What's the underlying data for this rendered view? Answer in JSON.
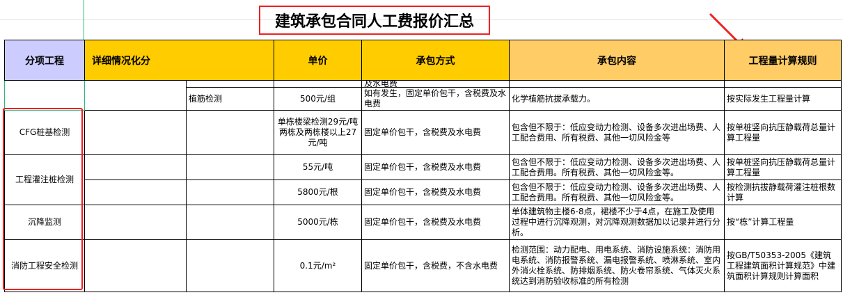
{
  "title": "建筑承包合同人工费报价汇总",
  "headers": [
    "分项工程",
    "详细情况化分",
    "单价",
    "承包方式",
    "承包内容",
    "工程量计算规则"
  ],
  "colors": {
    "header_lavender": "#ccccff",
    "header_yellow": "#ffcc00",
    "header_orange": "#ffcc66",
    "highlight_red": "#f02020"
  },
  "rows": [
    {
      "partial_method": "及水电费"
    },
    {
      "sub": "植筋检测",
      "price": "500元/组",
      "method": "如有发生，固定单价包干，含税费及水电费",
      "content": "化学植筋抗拔承载力。",
      "rule": "按实际发生工程量计算"
    },
    {
      "item": "CFG桩基检测",
      "price": "单栋楼梁检测29元/吨\n两栋及两栋楼以上27元/吨",
      "method": "固定单价包干，含税费及水电费",
      "content": "包含但不限于：低应变动力检测、设备多次进出场费、人工配合费用、所有税费、其他一切风险金等",
      "rule": "按单桩竖向抗压静载荷总量计算工程量"
    },
    {
      "item": "工程灌注桩检测",
      "price": "55元/吨",
      "method": "固定单价包干，含税费及水电费",
      "content": "包含但不限于：低应变动力检测、设备多次进出场费、人工配合费用。所有税费、其他一切风险金等。",
      "rule": "按单桩竖向抗压静载荷总量计算工程量"
    },
    {
      "price": "5800元/根",
      "method": "固定单价包干，含税费及水电费",
      "content": "包含但不限于：低应变动力检测、设备多次进出场费、人工配合费用。所有税费、其他一切风险金等。",
      "rule": "按检测抗拔静载荷灌注桩根数计算"
    },
    {
      "item": "沉降监测",
      "price": "5000元/栋",
      "method": "固定单价包干，含税费及水电费",
      "content": "单体建筑物主楼6-8点，裙楼不少于4点，在施工及使用过程中进行沉降观测，对沉降观测数据加以记录并进行分析。",
      "rule": "按“栋”计算工程量"
    },
    {
      "item": "消防工程安全检测",
      "price": "0.1元/m²",
      "method": "固定单价包干，含税费，不含水电费",
      "content": "检测范围：动力配电、用电系统、消防设施系统：消防用电系统、消防报警系统、漏电报警系统、喷淋系统、室内外消火栓系统、防排烟系统、防火卷帘系统、气体灭火系统达到消防验收标准的所有检测",
      "rule": "按GB/T50353-2005《建筑工程建筑面积计算规范》中建筑面积计算规则计算面积"
    }
  ]
}
